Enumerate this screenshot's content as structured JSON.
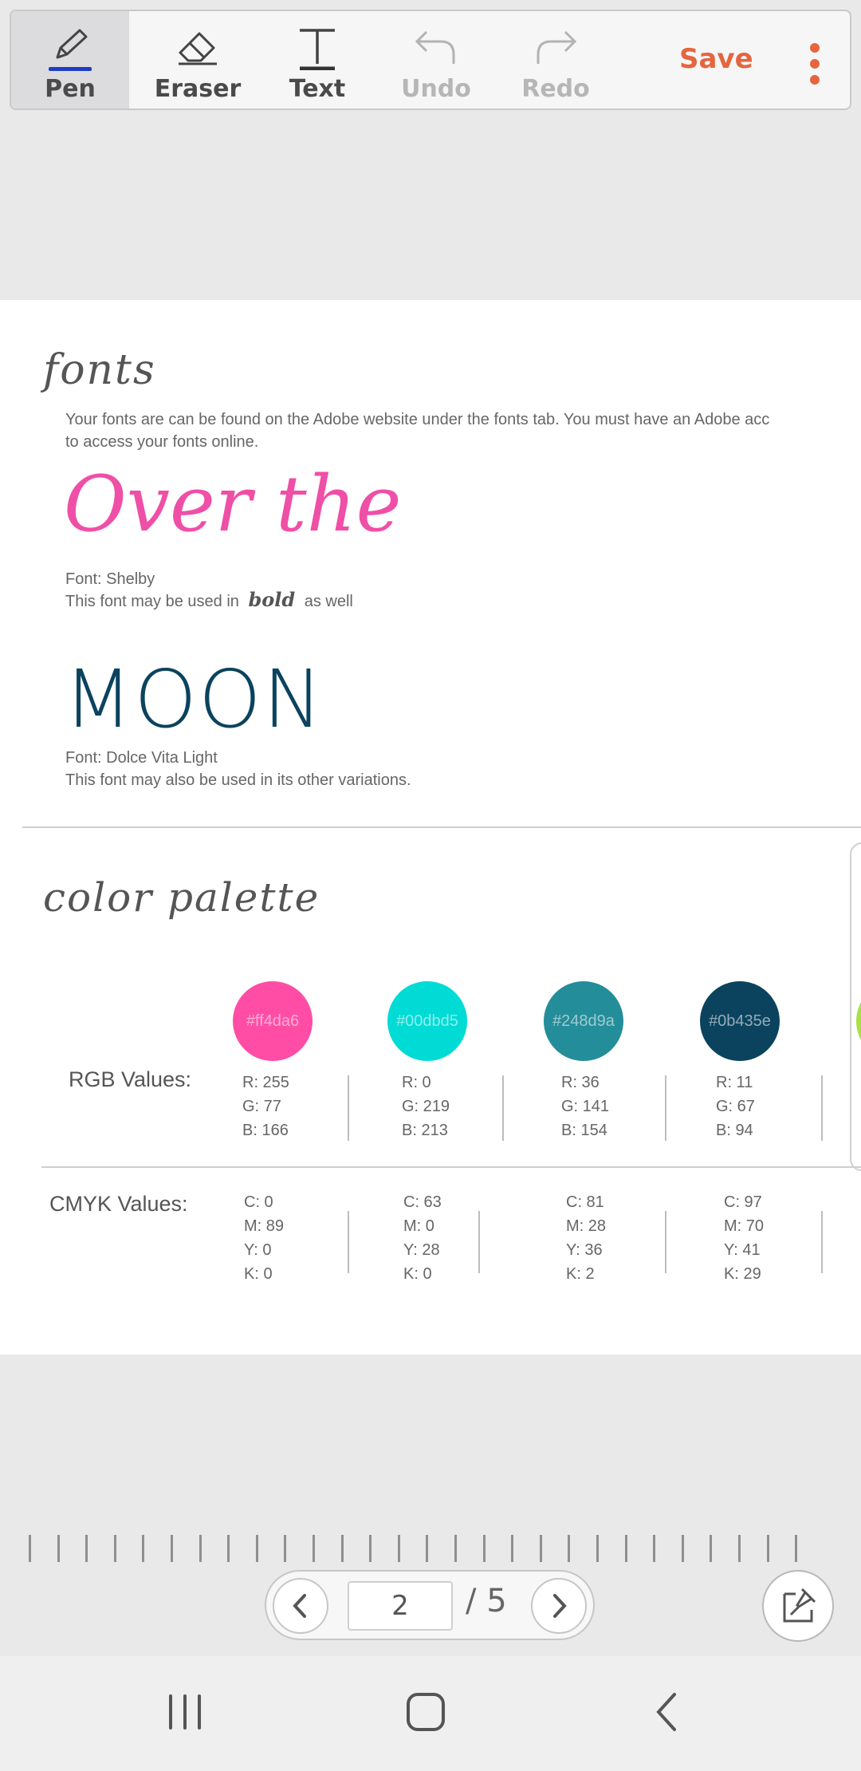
{
  "toolbar": {
    "tools": [
      {
        "label": "Pen"
      },
      {
        "label": "Eraser"
      },
      {
        "label": "Text"
      },
      {
        "label": "Undo"
      },
      {
        "label": "Redo"
      }
    ],
    "save_label": "Save",
    "colors": {
      "accent": "#e5653e",
      "pen_underline": "#1f3cc4"
    }
  },
  "document": {
    "fonts_heading": "fonts",
    "intro_text": "Your fonts are can be found on the Adobe website under the fonts tab. You must have an Adobe acc\nto access your fonts online.",
    "sample1_text": "Over the",
    "sample1_font": "Font: Shelby",
    "sample1_note_pre": "This font may be used in",
    "sample1_note_bold": "bold",
    "sample1_note_post": "as well",
    "sample2_text": "MOON",
    "sample2_font": "Font: Dolce Vita Light",
    "sample2_note": "This font may also be used in its other variations.",
    "palette_heading": "color palette",
    "rgb_label": "RGB Values:",
    "cmyk_label": "CMYK Values:",
    "swatches": [
      {
        "hex": "#ff4da6",
        "label": "#ff4da6",
        "r": "R: 255",
        "g": "G: 77",
        "b": "B: 166",
        "c": "C: 0",
        "m": "M: 89",
        "y": "Y: 0",
        "k": "K: 0"
      },
      {
        "hex": "#00dbd5",
        "label": "#00dbd5",
        "r": "R: 0",
        "g": "G: 219",
        "b": "B: 213",
        "c": "C: 63",
        "m": "M: 0",
        "y": "Y: 28",
        "k": "K: 0"
      },
      {
        "hex": "#248d9a",
        "label": "#248d9a",
        "r": "R: 36",
        "g": "G: 141",
        "b": "B: 154",
        "c": "C: 81",
        "m": "M: 28",
        "y": "Y: 36",
        "k": "K: 2"
      },
      {
        "hex": "#0b435e",
        "label": "#0b435e",
        "r": "R: 11",
        "g": "G: 67",
        "b": "B: 94",
        "c": "C: 97",
        "m": "M: 70",
        "y": "Y: 41",
        "k": "K: 29"
      }
    ],
    "fifth_swatch_color": "#a8e04a"
  },
  "pager": {
    "current_page": "2",
    "total": "/ 5"
  },
  "system_nav": {
    "icons": [
      "recents-icon",
      "home-icon",
      "back-icon"
    ]
  }
}
